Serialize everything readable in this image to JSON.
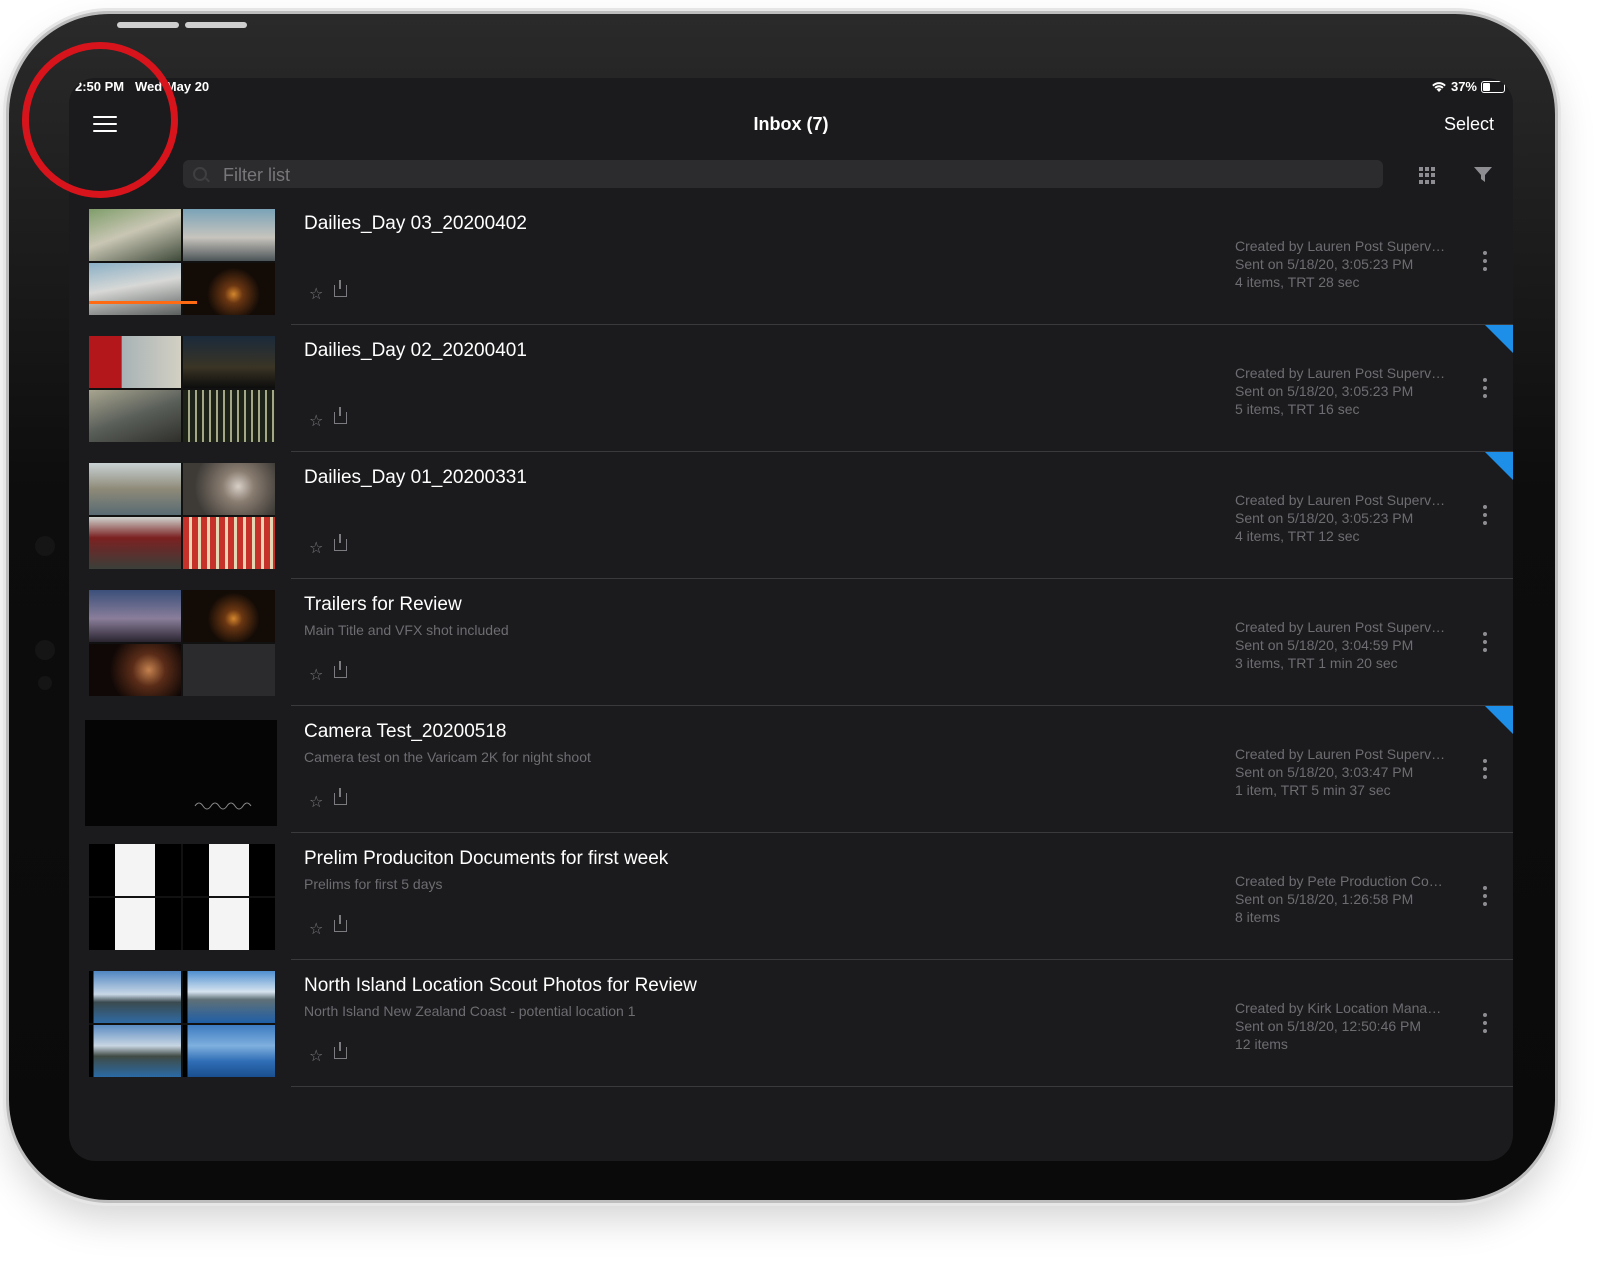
{
  "status_bar": {
    "time": "2:50 PM",
    "date": "Wed May 20",
    "battery": "37%"
  },
  "nav": {
    "title": "Inbox (7)",
    "select_label": "Select"
  },
  "search": {
    "placeholder": "Filter list"
  },
  "colors": {
    "accent_blue": "#1e8fe8",
    "progress_orange": "#ff6a13",
    "annotation_red": "#d7141b"
  },
  "items": [
    {
      "title": "Dailies_Day 03_20200402",
      "subtitle": "",
      "created": "Created by Lauren Post Superv…",
      "sent": "Sent on 5/18/20, 3:05:23 PM",
      "count": "4 items, TRT 28 sec"
    },
    {
      "title": "Dailies_Day 02_20200401",
      "subtitle": "",
      "created": "Created by Lauren Post Superv…",
      "sent": "Sent on 5/18/20, 3:05:23 PM",
      "count": "5 items, TRT 16 sec"
    },
    {
      "title": "Dailies_Day 01_20200331",
      "subtitle": "",
      "created": "Created by Lauren Post Superv…",
      "sent": "Sent on 5/18/20, 3:05:23 PM",
      "count": "4 items, TRT 12 sec"
    },
    {
      "title": "Trailers for Review",
      "subtitle": "Main Title and VFX shot included",
      "created": "Created by Lauren Post Superv…",
      "sent": "Sent on 5/18/20, 3:04:59 PM",
      "count": "3 items, TRT 1 min 20 sec"
    },
    {
      "title": "Camera Test_20200518",
      "subtitle": "Camera test on the Varicam 2K for night shoot",
      "created": "Created by Lauren Post Superv…",
      "sent": "Sent on 5/18/20, 3:03:47 PM",
      "count": "1 item, TRT 5 min 37 sec"
    },
    {
      "title": "Prelim Produciton Documents for first week",
      "subtitle": "Prelims for first 5 days",
      "created": "Created by Pete Production Co…",
      "sent": "Sent on 5/18/20, 1:26:58 PM",
      "count": "8 items"
    },
    {
      "title": "North Island Location Scout Photos for Review",
      "subtitle": "North Island New Zealand Coast - potential location 1",
      "created": "Created by Kirk Location Mana…",
      "sent": "Sent on 5/18/20, 12:50:46 PM",
      "count": "12 items"
    }
  ]
}
